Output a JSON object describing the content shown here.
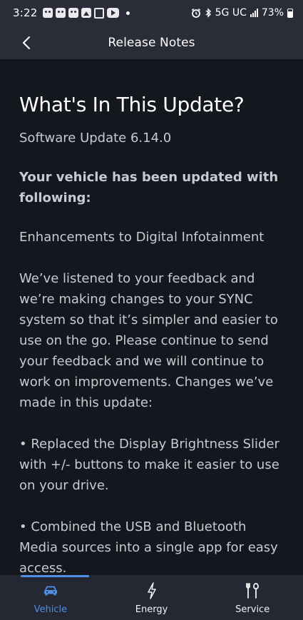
{
  "status_bar": {
    "time": "3:22",
    "network": "5G UC",
    "battery": "73%"
  },
  "header": {
    "title": "Release Notes"
  },
  "content": {
    "heading": "What's In This Update?",
    "subtitle": "Software Update 6.14.0",
    "bold_intro": "Your vehicle has been updated with following:",
    "section_title": "Enhancements to Digital Infotainment",
    "body": "We’ve listened to your feedback and we’re making changes to your SYNC system so that it’s simpler and easier to use on the go. Please continue to send your feedback and we will continue to work on improvements. Changes we’ve made in this update:",
    "bullets": [
      "• Replaced the Display Brightness Slider with +/- buttons to make it easier to use on your drive.",
      "• Combined the USB and Bluetooth Media sources into a single app for easy access."
    ]
  },
  "tabbar": {
    "accent_color": "#4f8fe6",
    "tabs": [
      {
        "label": "Vehicle",
        "icon": "car-icon",
        "active": true
      },
      {
        "label": "Energy",
        "icon": "lightning-icon",
        "active": false
      },
      {
        "label": "Service",
        "icon": "tools-icon",
        "active": false
      }
    ]
  }
}
